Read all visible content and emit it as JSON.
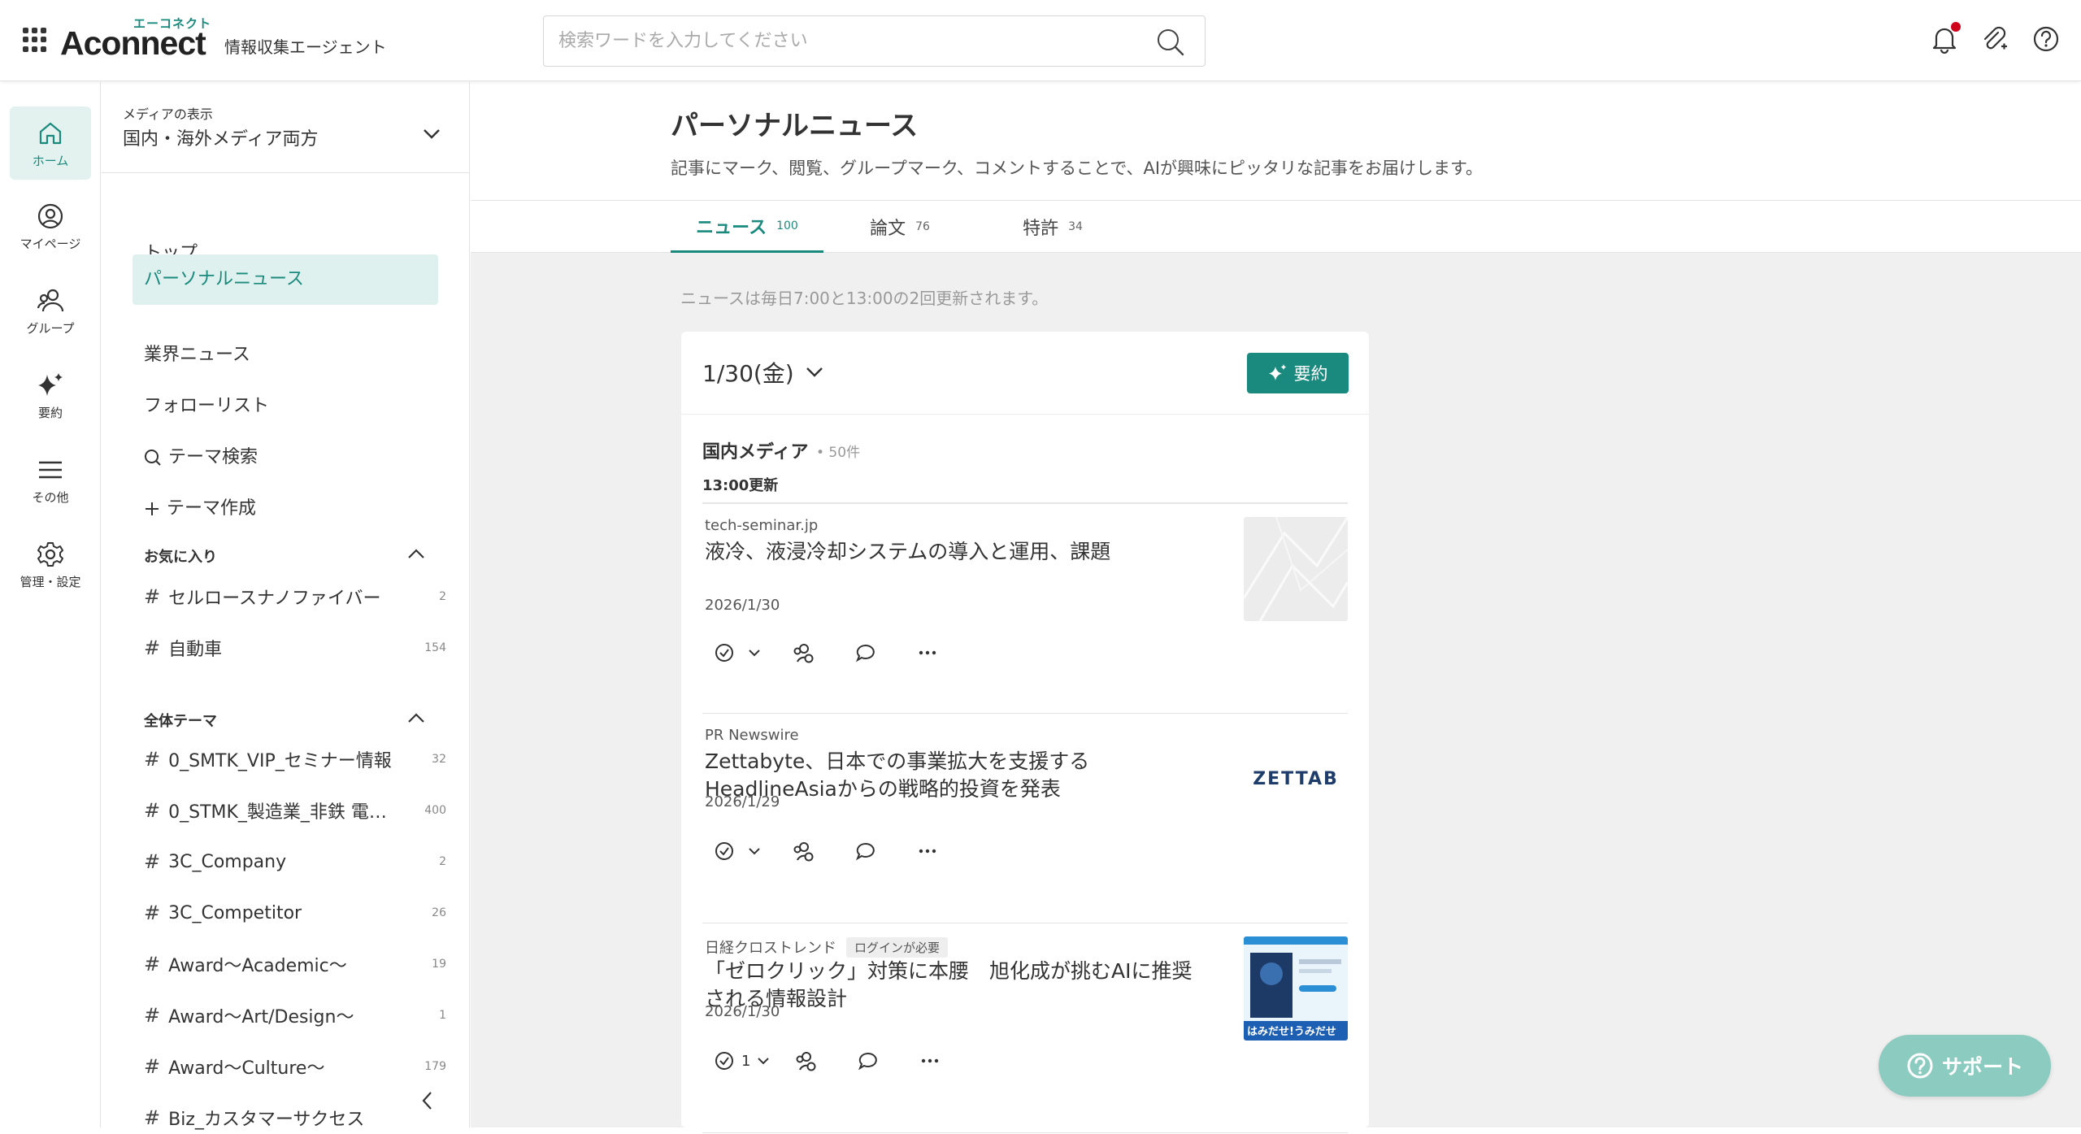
{
  "header": {
    "logo_kana": "エーコネクト",
    "logo_word": "Aconnect",
    "subtitle": "情報収集エージェント",
    "search_placeholder": "検索ワードを入力してください"
  },
  "rail": {
    "items": [
      {
        "label": "ホーム",
        "icon": "home-icon"
      },
      {
        "label": "マイページ",
        "icon": "user-circle-icon"
      },
      {
        "label": "グループ",
        "icon": "group-icon"
      },
      {
        "label": "要約",
        "icon": "sparkle-icon"
      },
      {
        "label": "その他",
        "icon": "menu-icon"
      },
      {
        "label": "管理・設定",
        "icon": "gear-icon"
      }
    ]
  },
  "sidebar": {
    "media_label": "メディアの表示",
    "media_value": "国内・海外メディア両方",
    "nav": [
      {
        "label": "トップ"
      },
      {
        "label": "パーソナルニュース"
      },
      {
        "label": "業界ニュース"
      },
      {
        "label": "フォローリスト"
      },
      {
        "label": "テーマ検索"
      },
      {
        "label": "テーマ作成"
      }
    ],
    "favorites_title": "お気に入り",
    "favorites": [
      {
        "name": "セルロースナノファイバー",
        "count": "2"
      },
      {
        "name": "自動車",
        "count": "154"
      }
    ],
    "all_title": "全体テーマ",
    "themes": [
      {
        "name": "0_SMTK_VIP_セミナー情報",
        "count": "32"
      },
      {
        "name": "0_STMK_製造業_非鉄 電…",
        "count": "400"
      },
      {
        "name": "3C_Company",
        "count": "2"
      },
      {
        "name": "3C_Competitor",
        "count": "26"
      },
      {
        "name": "Award〜Academic〜",
        "count": "19"
      },
      {
        "name": "Award〜Art/Design〜",
        "count": "1"
      },
      {
        "name": "Award〜Culture〜",
        "count": "179"
      },
      {
        "name": "Biz_カスタマーサクセス",
        "count": ""
      }
    ]
  },
  "main": {
    "title": "パーソナルニュース",
    "description": "記事にマーク、閲覧、グループマーク、コメントすることで、AIが興味にピッタリな記事をお届けします。",
    "tabs": [
      {
        "label": "ニュース",
        "count": "100"
      },
      {
        "label": "論文",
        "count": "76"
      },
      {
        "label": "特許",
        "count": "34"
      }
    ],
    "update_note": "ニュースは毎日7:00と13:00の2回更新されます。",
    "date": "1/30(金)",
    "summary_button": "要約",
    "group": {
      "title": "国内メディア",
      "count": "• 50件",
      "update": "13:00更新"
    },
    "articles": [
      {
        "source": "tech-seminar.jp",
        "title": "液冷、液浸冷却システムの導入と運用、課題",
        "date": "2026/1/30",
        "login": "",
        "check_count": ""
      },
      {
        "source": "PR Newswire",
        "title": "Zettabyte、日本での事業拡大を支援するHeadlineAsiaからの戦略的投資を発表",
        "date": "2026/1/29",
        "login": "",
        "check_count": "",
        "thumb_text": "ZETTAB"
      },
      {
        "source": "日経クロストレンド",
        "title": "「ゼロクリック」対策に本腰　旭化成が挑むAIに推奨される情報設計",
        "date": "2026/1/30",
        "login": "ログインが必要",
        "check_count": "1",
        "thumb_text": "はみだせ!うみだせ"
      }
    ]
  },
  "support_label": "サポート",
  "colors": {
    "accent": "#1a8a7e",
    "accent_light": "#dff1ee",
    "support": "#8ccbbf",
    "notification": "#d0021b"
  }
}
